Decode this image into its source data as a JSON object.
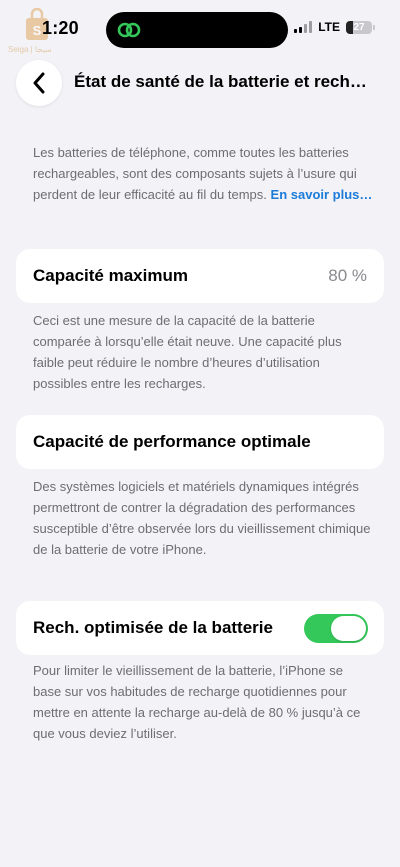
{
  "status": {
    "time": "1:20",
    "network": "LTE",
    "battery": "27",
    "battery_level_percent": 27
  },
  "watermark": {
    "text": "Seiga | ﺳﻴﺠﺎ"
  },
  "nav": {
    "title": "État de santé de la batterie et rech…"
  },
  "intro": {
    "text": "Les batteries de téléphone, comme toutes les batteries rechargeables, sont des composants sujets à l’usure qui perdent de leur efficacité au fil du temps.",
    "link": "En savoir plus…"
  },
  "max_capacity": {
    "label": "Capacité maximum",
    "value": "80 %",
    "description": "Ceci est une mesure de la capacité de la batterie comparée à lorsqu’elle était neuve. Une capacité plus faible peut réduire le nombre d’heures d’utilisation possibles entre les recharges."
  },
  "peak_performance": {
    "label": "Capacité de performance optimale",
    "description": "Des systèmes logiciels et matériels dynamiques intégrés permettront de contrer la dégradation des performances susceptible d’être observée lors du vieillissement chimique de la batterie de votre iPhone."
  },
  "optimized_charging": {
    "label": "Rech. optimisée de la batterie",
    "enabled": true,
    "description": "Pour limiter le vieillissement de la batterie, l’iPhone se base sur vos habitudes de recharge quotidiennes pour mettre en attente la recharge au-delà de 80 % jusqu’à ce que vous deviez l’utiliser."
  },
  "colors": {
    "accent_link": "#1a7bd8",
    "toggle_on": "#34c759",
    "background": "#f2f2f7"
  }
}
